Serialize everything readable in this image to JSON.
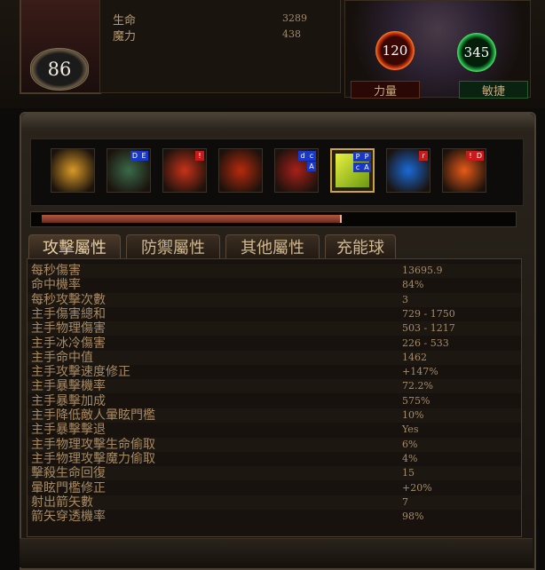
{
  "character": {
    "level": "86",
    "life_label": "生命",
    "life_value": "3289",
    "mana_label": "魔力",
    "mana_value": "438"
  },
  "attributes": {
    "strength_value": "120",
    "strength_label": "力量",
    "dexterity_value": "345",
    "dexterity_label": "敏捷"
  },
  "skills": [
    {
      "name": "sword-skill-icon",
      "tags": [],
      "color": "#d89a28"
    },
    {
      "name": "portrait-skill-icon",
      "tags": [
        {
          "t": "E",
          "c": "blue"
        },
        {
          "t": "D",
          "c": "blue"
        }
      ],
      "color": "#3a6a4a"
    },
    {
      "name": "fire-skill-icon",
      "tags": [
        {
          "t": "!",
          "c": "red"
        }
      ],
      "color": "#c83218"
    },
    {
      "name": "ember-skill-icon",
      "tags": [],
      "color": "#b82a0c"
    },
    {
      "name": "demon-skill-icon",
      "tags": [
        {
          "t": "c",
          "c": "blue"
        },
        {
          "t": "d",
          "c": "blue"
        },
        {
          "t": "A",
          "c": "blue"
        }
      ],
      "color": "#a8201a"
    },
    {
      "name": "leaf-skill-icon",
      "tags": [
        {
          "t": "P",
          "c": "blue"
        },
        {
          "t": "P",
          "c": "blue"
        },
        {
          "t": "A",
          "c": "blue"
        },
        {
          "t": "c",
          "c": "blue"
        }
      ],
      "color": "#b8c818"
    },
    {
      "name": "ice-skill-icon",
      "tags": [
        {
          "t": "r",
          "c": "red"
        }
      ],
      "color": "#1a6ad8"
    },
    {
      "name": "flame-figure-skill-icon",
      "tags": [
        {
          "t": "D",
          "c": "red"
        },
        {
          "t": "!",
          "c": "red"
        }
      ],
      "color": "#e85a18"
    }
  ],
  "progress": {
    "experience_fraction": 0.63
  },
  "tabs": [
    {
      "label": "攻擊屬性",
      "active": true
    },
    {
      "label": "防禦屬性",
      "active": false
    },
    {
      "label": "其他屬性",
      "active": false
    },
    {
      "label": "充能球",
      "active": false
    }
  ],
  "stats": [
    {
      "name": "每秒傷害",
      "value": "13695.9"
    },
    {
      "name": "命中機率",
      "value": "84%"
    },
    {
      "name": "每秒攻擊次數",
      "value": "3"
    },
    {
      "name": "主手傷害總和",
      "value": "729 - 1750"
    },
    {
      "name": "主手物理傷害",
      "value": "503 - 1217"
    },
    {
      "name": "主手冰冷傷害",
      "value": "226 - 533"
    },
    {
      "name": "主手命中值",
      "value": "1462"
    },
    {
      "name": "主手攻擊速度修正",
      "value": "+147%"
    },
    {
      "name": "主手暴擊機率",
      "value": "72.2%"
    },
    {
      "name": "主手暴擊加成",
      "value": "575%"
    },
    {
      "name": "主手降低敵人暈眩門檻",
      "value": "10%"
    },
    {
      "name": "主手暴擊擊退",
      "value": "Yes"
    },
    {
      "name": "主手物理攻擊生命偷取",
      "value": "6%"
    },
    {
      "name": "主手物理攻擊魔力偷取",
      "value": "4%"
    },
    {
      "name": "擊殺生命回復",
      "value": "15"
    },
    {
      "name": "暈眩門檻修正",
      "value": "+20%"
    },
    {
      "name": "射出箭矢數",
      "value": "7"
    },
    {
      "name": "箭矢穿透機率",
      "value": "98%"
    }
  ]
}
